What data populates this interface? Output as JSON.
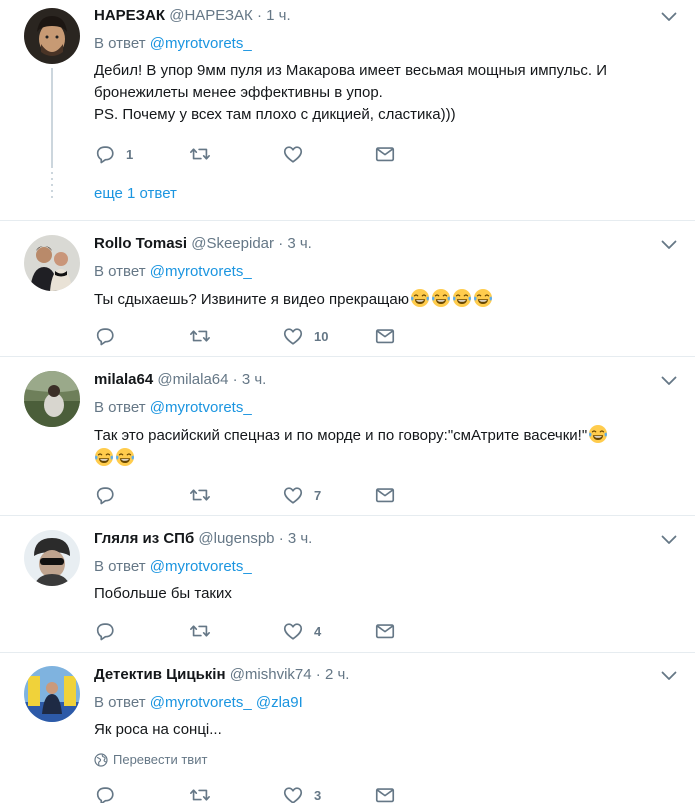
{
  "reply_prefix": "В ответ",
  "tweets": [
    {
      "name": "НАРЕЗАК",
      "handle": "@НАРЕЗАК",
      "time": "1 ч.",
      "reply_to": "@myrotvorets_",
      "text_lines": [
        "Дебил! В упор 9мм пуля из Макарова имеет весьмая мощныя импульс. И",
        "бронежилеты менее эффективны в упор.",
        "PS. Почему у всех там плохо с дикцией, сластика)))"
      ],
      "replies": "1",
      "retweets": "",
      "likes": "",
      "more_replies": "еще 1 ответ"
    },
    {
      "name": "Rollo Tomasi",
      "handle": "@Skeepidar",
      "time": "3 ч.",
      "reply_to": "@myrotvorets_",
      "text_lines": [
        "Ты сдыхаешь? Извините я видео прекращаю"
      ],
      "emoji": "😂😂😂😂",
      "replies": "",
      "retweets": "",
      "likes": "10"
    },
    {
      "name": "milala64",
      "handle": "@milala64",
      "time": "3 ч.",
      "reply_to": "@myrotvorets_",
      "text_lines": [
        "Так это расийский спецназ и по морде и по говору:\"смАтрите васечки!\""
      ],
      "emoji_line2": "😂😂",
      "replies": "",
      "retweets": "",
      "likes": "7"
    },
    {
      "name": "Гляля из СПб",
      "handle": "@lugenspb",
      "time": "3 ч.",
      "reply_to": "@myrotvorets_",
      "text_lines": [
        "Побольше бы таких"
      ],
      "replies": "",
      "retweets": "",
      "likes": "4"
    },
    {
      "name": "Детектив Цицькін",
      "handle": "@mishvik74",
      "time": "2 ч.",
      "reply_to": "@myrotvorets_",
      "reply_to_2": "@zla9I",
      "text_lines": [
        "Як роса на сонці..."
      ],
      "translate": "Перевести твит",
      "replies": "",
      "retweets": "",
      "likes": "3"
    }
  ],
  "colors": {
    "link": "#1b95e0",
    "muted": "#657786",
    "divider": "#e6ecf0"
  }
}
